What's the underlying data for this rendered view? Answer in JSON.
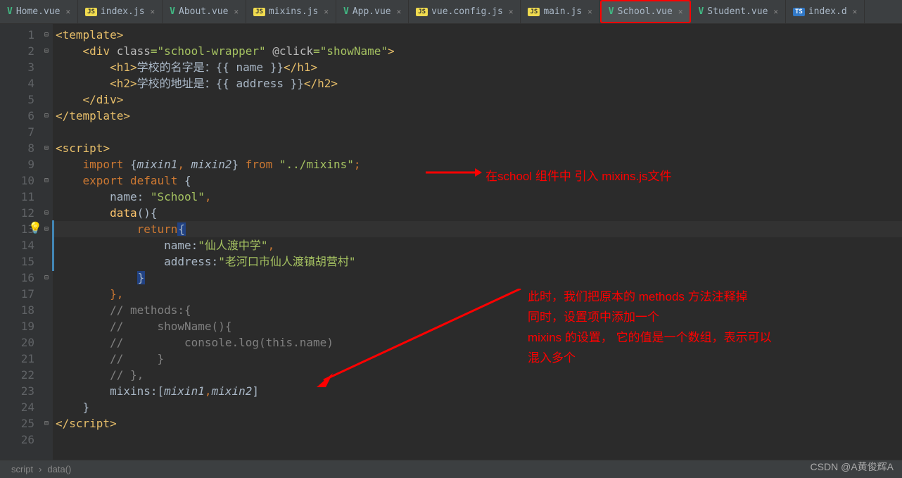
{
  "tabs": [
    {
      "icon": "vue",
      "name": "Home.vue"
    },
    {
      "icon": "js",
      "name": "index.js"
    },
    {
      "icon": "vue",
      "name": "About.vue"
    },
    {
      "icon": "js",
      "name": "mixins.js"
    },
    {
      "icon": "vue",
      "name": "App.vue"
    },
    {
      "icon": "js",
      "name": "vue.config.js"
    },
    {
      "icon": "js",
      "name": "main.js"
    },
    {
      "icon": "vue",
      "name": "School.vue",
      "active": true,
      "highlighted": true
    },
    {
      "icon": "vue",
      "name": "Student.vue"
    },
    {
      "icon": "ts",
      "name": "index.d"
    }
  ],
  "gutter_lines": [
    "1",
    "2",
    "3",
    "4",
    "5",
    "6",
    "7",
    "8",
    "9",
    "10",
    "11",
    "12",
    "13",
    "14",
    "15",
    "16",
    "17",
    "18",
    "19",
    "20",
    "21",
    "22",
    "23",
    "24",
    "25",
    "26"
  ],
  "code": {
    "l1": {
      "a": "<",
      "b": "template",
      "c": ">"
    },
    "l2": {
      "a": "    <",
      "b": "div ",
      "c": "class",
      "d": "=",
      "e": "\"school-wrapper\" ",
      "f": "@click",
      "g": "=",
      "h": "\"showName\"",
      "i": ">"
    },
    "l3": {
      "a": "        <",
      "b": "h1",
      "c": ">",
      "d": "学校的名字是：",
      "e": "{{ name }}",
      "f": "</",
      "g": "h1",
      "h": ">"
    },
    "l4": {
      "a": "        <",
      "b": "h2",
      "c": ">",
      "d": "学校的地址是：",
      "e": "{{ address }}",
      "f": "</",
      "g": "h2",
      "h": ">"
    },
    "l5": {
      "a": "    </",
      "b": "div",
      "c": ">"
    },
    "l6": {
      "a": "</",
      "b": "template",
      "c": ">"
    },
    "l8": {
      "a": "<",
      "b": "script",
      "c": ">"
    },
    "l9": {
      "a": "    ",
      "b": "import ",
      "c": "{",
      "d": "mixin1",
      "e": ", ",
      "f": "mixin2",
      "g": "} ",
      "h": "from ",
      "i": "\"../mixins\"",
      "j": ";"
    },
    "l10": {
      "a": "    ",
      "b": "export default ",
      "c": "{"
    },
    "l11": {
      "a": "        name: ",
      "b": "\"School\"",
      "c": ","
    },
    "l12": {
      "a": "        ",
      "b": "data",
      "c": "(){"
    },
    "l13": {
      "a": "            ",
      "b": "return",
      "c": "{"
    },
    "l14": {
      "a": "                name:",
      "b": "\"仙人渡中学\"",
      "c": ","
    },
    "l15": {
      "a": "                address:",
      "b": "\"老河口市仙人渡镇胡营村\""
    },
    "l16": {
      "a": "            ",
      "b": "}"
    },
    "l17": {
      "a": "        },"
    },
    "l18": {
      "a": "        ",
      "b": "// methods:{"
    },
    "l19": {
      "a": "        ",
      "b": "//     showName(){"
    },
    "l20": {
      "a": "        ",
      "b": "//         console.log(this.name)"
    },
    "l21": {
      "a": "        ",
      "b": "//     }"
    },
    "l22": {
      "a": "        ",
      "b": "// },"
    },
    "l23": {
      "a": "        mixins:[",
      "b": "mixin1",
      "c": ",",
      "d": "mixin2",
      "e": "]"
    },
    "l24": {
      "a": "    }"
    },
    "l25": {
      "a": "</",
      "b": "script",
      "c": ">"
    }
  },
  "breadcrumb": {
    "a": "script",
    "b": "data()"
  },
  "annotations": {
    "ann1": "在school 组件中 引入 mixins.js文件",
    "ann2_l1": "此时，我们把原本的 methods 方法注释掉",
    "ann2_l2": "同时，设置项中添加一个",
    "ann2_l3": "mixins 的设置， 它的值是一个数组，表示可以",
    "ann2_l4": "混入多个"
  },
  "watermark": "CSDN @A黄俊辉A"
}
